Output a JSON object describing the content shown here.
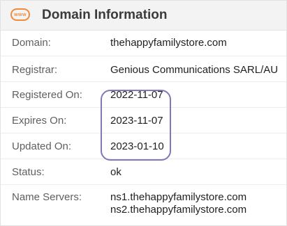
{
  "header": {
    "icon_text": "www",
    "title": "Domain Information"
  },
  "rows": [
    {
      "label": "Domain:",
      "value": "thehappyfamilystore.com"
    },
    {
      "label": "Registrar:",
      "value": "Genious Communications SARL/AU"
    },
    {
      "label": "Registered On:",
      "value": "2022-11-07"
    },
    {
      "label": "Expires On:",
      "value": "2023-11-07"
    },
    {
      "label": "Updated On:",
      "value": "2023-01-10"
    },
    {
      "label": "Status:",
      "value": "ok"
    },
    {
      "label": "Name Servers:",
      "values": [
        "ns1.thehappyfamilystore.com",
        "ns2.thehappyfamilystore.com"
      ]
    }
  ],
  "colors": {
    "icon_accent": "#f28a3c",
    "highlight_outline": "#8377b7",
    "header_bg": "#f3f3f3"
  }
}
